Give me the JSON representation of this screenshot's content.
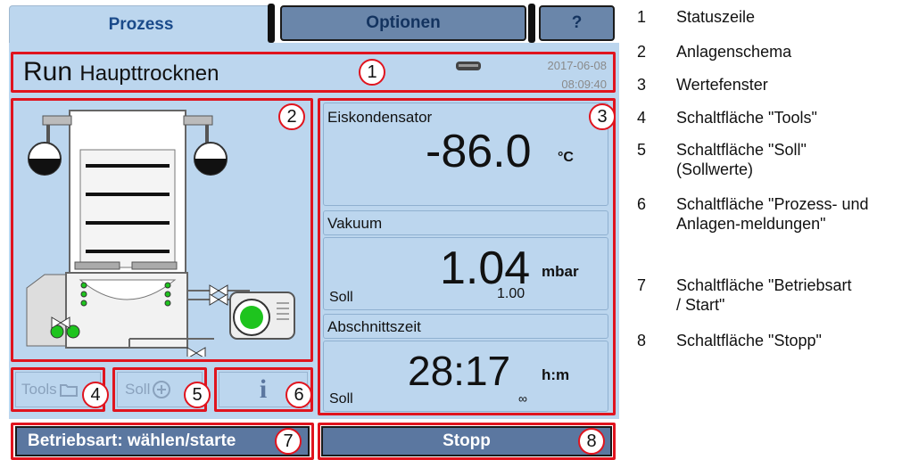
{
  "tabs": {
    "prozess": "Prozess",
    "optionen": "Optionen",
    "help": "?"
  },
  "status": {
    "mode": "Run",
    "step": "Haupttrocknen",
    "date": "2017-06-08",
    "time": "08:09:40"
  },
  "values": {
    "eis": {
      "label": "Eiskondensator",
      "value": "-86.0",
      "unit": "°C"
    },
    "vakuum": {
      "label": "Vakuum",
      "value": "1.04",
      "unit": "mbar",
      "soll_label": "Soll",
      "soll_value": "1.00"
    },
    "zeit": {
      "label": "Abschnittszeit",
      "value": "28:17",
      "unit": "h:m",
      "soll_label": "Soll",
      "soll_value": "∞"
    }
  },
  "buttons": {
    "tools": "Tools",
    "soll": "Soll",
    "info": "i",
    "betriebsart": "Betriebsart: wählen/starte",
    "stopp": "Stopp"
  },
  "callouts": [
    "1",
    "2",
    "3",
    "4",
    "5",
    "6",
    "7",
    "8"
  ],
  "legend": [
    {
      "num": "1",
      "text": "Statuszeile"
    },
    {
      "num": "2",
      "text": "Anlagenschema"
    },
    {
      "num": "3",
      "text": "Wertefenster"
    },
    {
      "num": "4",
      "text": "Schaltfläche \"Tools\""
    },
    {
      "num": "5",
      "text": "Schaltfläche \"Soll\" (Sollwerte)"
    },
    {
      "num": "6",
      "text": "Schaltfläche \"Prozess- und Anlagen-meldungen\""
    },
    {
      "num": "7",
      "text": "Schaltfläche \"Betriebsart / Start\""
    },
    {
      "num": "8",
      "text": "Schaltfläche \"Stopp\""
    }
  ],
  "colors": {
    "panel": "#bcd6ee",
    "accent_red": "#e0141e",
    "button_dark": "#5b77a0"
  }
}
